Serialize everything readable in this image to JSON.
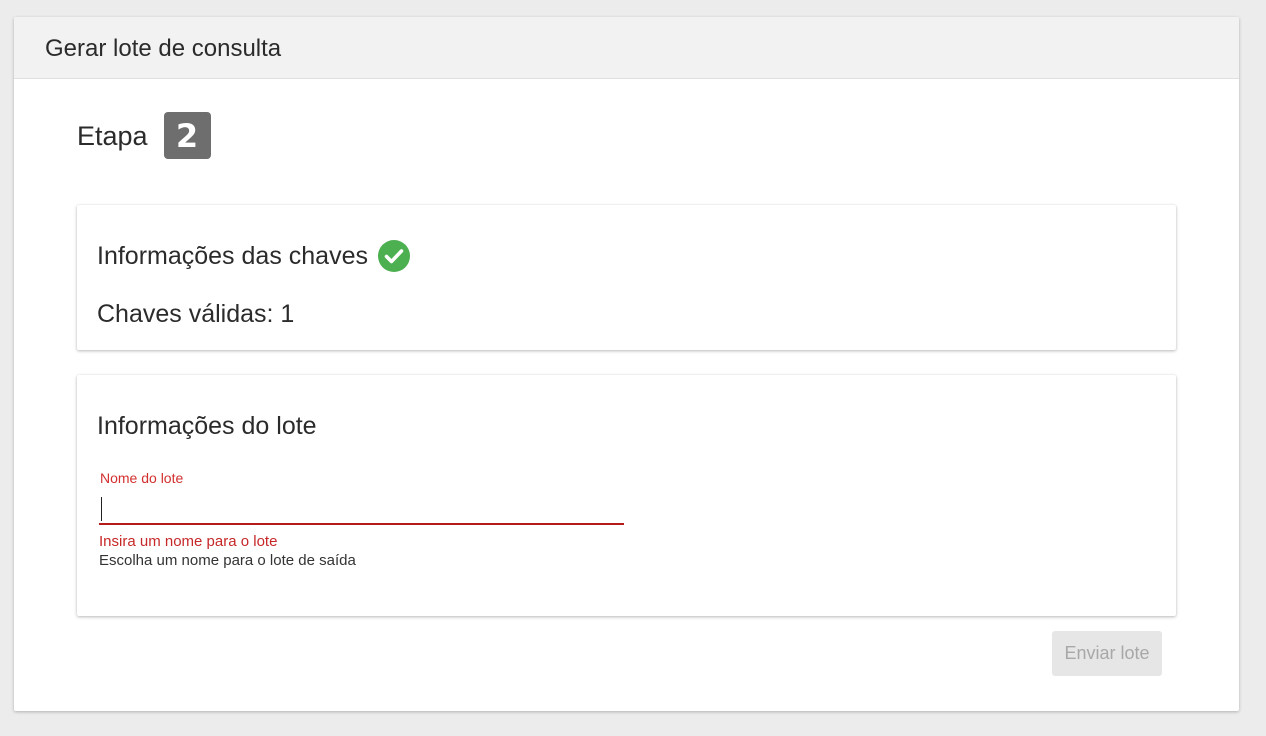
{
  "header": {
    "title": "Gerar lote de consulta"
  },
  "step": {
    "label": "Etapa",
    "number": "2"
  },
  "keys_card": {
    "heading": "Informações das chaves",
    "status_icon": "check-circle-icon",
    "status_color": "#4caf50",
    "valid_keys_label": "Chaves válidas: 1"
  },
  "batch_card": {
    "heading": "Informações do lote",
    "name_field": {
      "label": "Nome do lote",
      "value": "",
      "error": "Insira um nome para o lote",
      "hint": "Escolha um nome para o lote de saída"
    }
  },
  "actions": {
    "submit_label": "Enviar lote"
  },
  "colors": {
    "error": "#d32f2f",
    "badge": "#6e6e6e"
  }
}
